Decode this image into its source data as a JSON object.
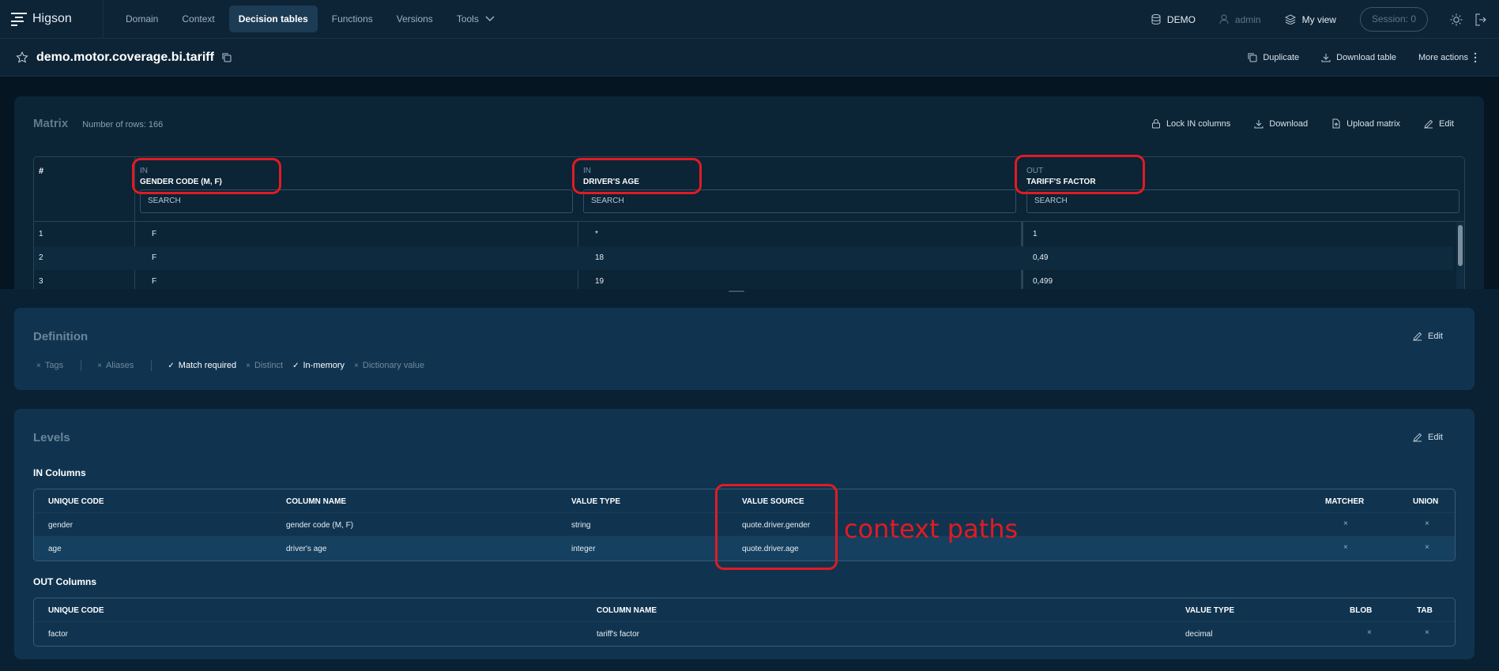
{
  "app": {
    "name": "Higson"
  },
  "nav": {
    "items": [
      {
        "label": "Domain",
        "active": false
      },
      {
        "label": "Context",
        "active": false
      },
      {
        "label": "Decision tables",
        "active": true
      },
      {
        "label": "Functions",
        "active": false
      },
      {
        "label": "Versions",
        "active": false
      },
      {
        "label": "Tools",
        "active": false
      }
    ]
  },
  "topbar": {
    "env": "DEMO",
    "user": "admin",
    "view": "My view",
    "session": "Session: 0"
  },
  "title": {
    "name": "demo.motor.coverage.bi.tariff",
    "actions": {
      "duplicate": "Duplicate",
      "download_table": "Download table",
      "more_actions": "More actions"
    }
  },
  "matrix": {
    "title": "Matrix",
    "rows_info": "Number of rows: 166",
    "actions": {
      "lock": "Lock IN columns",
      "download": "Download",
      "upload": "Upload matrix",
      "edit": "Edit"
    },
    "hash": "#",
    "columns": [
      {
        "dir": "IN",
        "name": "GENDER CODE (M, F)",
        "search": "SEARCH"
      },
      {
        "dir": "IN",
        "name": "DRIVER'S AGE",
        "search": "SEARCH"
      },
      {
        "dir": "OUT",
        "name": "TARIFF'S FACTOR",
        "search": "SEARCH"
      }
    ],
    "rows": [
      {
        "n": "1",
        "gender": "F",
        "age": "*",
        "factor": "1"
      },
      {
        "n": "2",
        "gender": "F",
        "age": "18",
        "factor": "0,49"
      },
      {
        "n": "3",
        "gender": "F",
        "age": "19",
        "factor": "0,499"
      }
    ]
  },
  "definition": {
    "title": "Definition",
    "edit": "Edit",
    "flags": [
      {
        "label": "Tags",
        "on": false,
        "mark": "×"
      },
      {
        "label": "Aliases",
        "on": false,
        "mark": "×"
      },
      {
        "label": "Match required",
        "on": true,
        "mark": "✓"
      },
      {
        "label": "Distinct",
        "on": false,
        "mark": "×"
      },
      {
        "label": "In-memory",
        "on": true,
        "mark": "✓"
      },
      {
        "label": "Dictionary value",
        "on": false,
        "mark": "×"
      }
    ]
  },
  "levels": {
    "title": "Levels",
    "edit": "Edit",
    "in_title": "IN Columns",
    "in_headers": {
      "code": "UNIQUE CODE",
      "name": "COLUMN NAME",
      "type": "VALUE TYPE",
      "source": "VALUE SOURCE",
      "matcher": "MATCHER",
      "union": "UNION"
    },
    "in_rows": [
      {
        "code": "gender",
        "name": "gender code (M, F)",
        "type": "string",
        "source": "quote.driver.gender",
        "matcher": "×",
        "union": "×"
      },
      {
        "code": "age",
        "name": "driver's age",
        "type": "integer",
        "source": "quote.driver.age",
        "matcher": "×",
        "union": "×"
      }
    ],
    "out_title": "OUT Columns",
    "out_headers": {
      "code": "UNIQUE CODE",
      "name": "COLUMN NAME",
      "type": "VALUE TYPE",
      "blob": "BLOB",
      "tab": "TAB"
    },
    "out_rows": [
      {
        "code": "factor",
        "name": "tariff's factor",
        "type": "decimal",
        "blob": "×",
        "tab": "×"
      }
    ]
  },
  "annotation": {
    "text": "context paths",
    "color": "#e11b22"
  },
  "colors": {
    "background": "#0a2134",
    "panel": "#103450",
    "accent": "#1c3c55",
    "annotation": "#e11b22"
  }
}
